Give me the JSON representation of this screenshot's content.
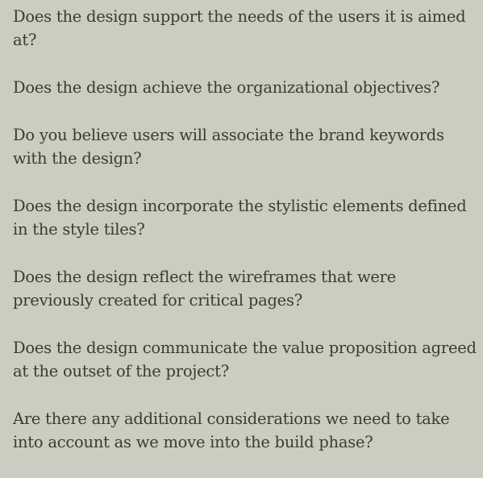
{
  "questions": [
    "Does the design support the needs of the users it is aimed at?",
    "Does the design achieve the organizational objectives?",
    "Do you believe users will associate the brand keywords with the design?",
    "Does the design incorporate the stylistic elements defined in the style tiles?",
    "Does the design reflect the wireframes that were previously created for critical pages?",
    "Does the design communicate the value proposition agreed at the outset of the project?",
    "Are there any additional considerations we need to take into account as we move into the build phase?"
  ]
}
